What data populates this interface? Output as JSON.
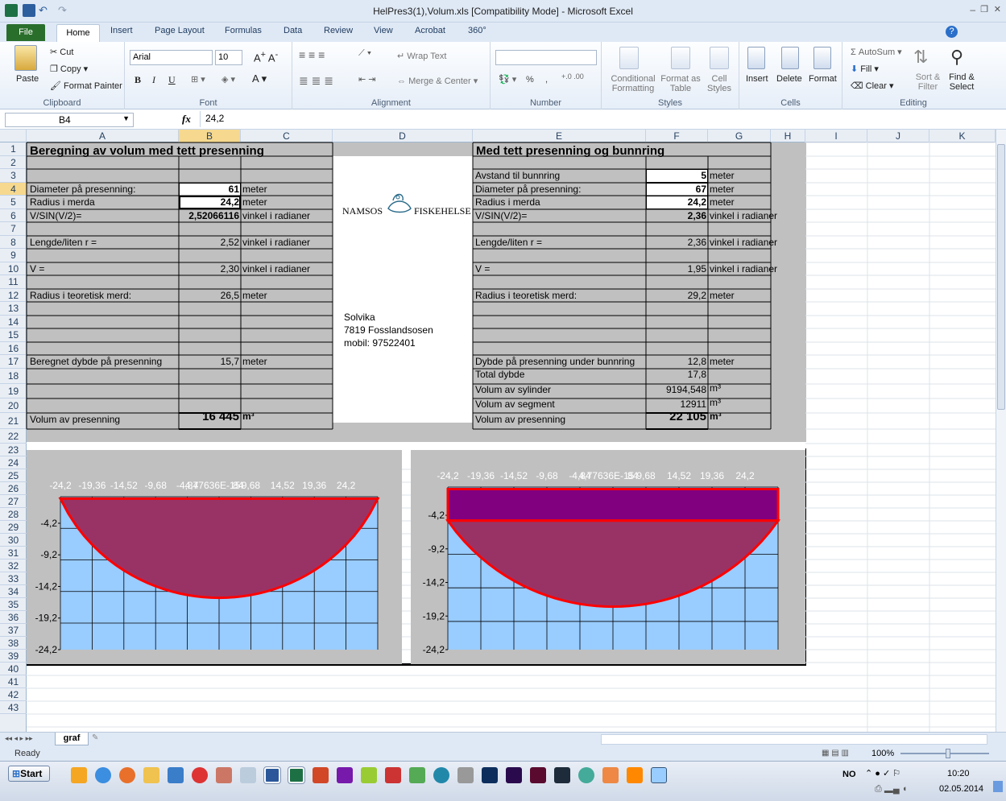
{
  "window": {
    "title": "HelPres3(1),Volum.xls  [Compatibility Mode]  -  Microsoft Excel",
    "min": "–",
    "max": "❐",
    "close": "✕"
  },
  "menu": {
    "file": "File",
    "tabs": [
      "Home",
      "Insert",
      "Page Layout",
      "Formulas",
      "Data",
      "Review",
      "View",
      "Acrobat",
      "360°"
    ]
  },
  "ribbon": {
    "clipboard": {
      "paste": "Paste",
      "cut": "Cut",
      "copy": "Copy",
      "format_painter": "Format Painter",
      "label": "Clipboard"
    },
    "font": {
      "name": "Arial",
      "size": "10",
      "label": "Font"
    },
    "alignment": {
      "wrap": "Wrap Text",
      "merge": "Merge & Center",
      "label": "Alignment"
    },
    "number": {
      "format": "",
      "percent": "%",
      "label": "Number"
    },
    "styles": {
      "conditional": "Conditional Formatting",
      "table": "Format as Table",
      "cell": "Cell Styles",
      "label": "Styles"
    },
    "cells": {
      "insert": "Insert",
      "delete": "Delete",
      "format": "Format",
      "label": "Cells"
    },
    "editing": {
      "autosum": "AutoSum",
      "fill": "Fill",
      "clear": "Clear",
      "sort": "Sort & Filter",
      "find": "Find & Select",
      "label": "Editing"
    }
  },
  "formula": {
    "cell": "B4",
    "fx": "fx",
    "value": "24,2"
  },
  "columns": [
    "A",
    "B",
    "C",
    "D",
    "E",
    "F",
    "G",
    "H",
    "I",
    "J",
    "K"
  ],
  "rows": [
    "1",
    "2",
    "3",
    "4",
    "5",
    "6",
    "7",
    "8",
    "9",
    "10",
    "11",
    "12",
    "13",
    "14",
    "15",
    "16",
    "17",
    "18",
    "19",
    "20",
    "21",
    "22",
    "23",
    "24",
    "25",
    "26",
    "27",
    "28",
    "29",
    "30",
    "31",
    "32",
    "33",
    "34",
    "35",
    "36",
    "37",
    "38",
    "39",
    "40",
    "41",
    "42",
    "43"
  ],
  "left_table": {
    "title": "Beregning av volum med tett presenning",
    "r3": {
      "a": "Diameter på presenning:",
      "b": "61",
      "c": "meter"
    },
    "r4": {
      "a": "Radius i merda",
      "b": "24,2",
      "c": "meter"
    },
    "r5": {
      "a": "V/SIN(V/2)=",
      "b": "2,52066116",
      "c": "vinkel i radianer"
    },
    "r7": {
      "a": "Lengde/liten r =",
      "b": "2,52",
      "c": "vinkel i radianer"
    },
    "r9": {
      "a": "V =",
      "b": "2,30",
      "c": "vinkel i radianer"
    },
    "r11": {
      "a": "Radius i teoretisk merd:",
      "b": "26,5",
      "c": "meter"
    },
    "r16": {
      "a": "Beregnet dybde på presenning",
      "b": "15,7",
      "c": "meter"
    },
    "r20": {
      "a": "Volum av presenning",
      "b": "16 445",
      "c": "m³"
    }
  },
  "logo": {
    "left": "NAMSOS",
    "right": "FISKEHELSE",
    "addr1": "Solvika",
    "addr2": "7819 Fosslandsosen",
    "addr3": "mobil: 97522401"
  },
  "right_table": {
    "title": "Med tett presenning og bunnring",
    "r2": {
      "e": "Avstand til bunnring",
      "f": "5",
      "g": "meter"
    },
    "r3": {
      "e": "Diameter på presenning:",
      "f": "67",
      "g": "meter"
    },
    "r4": {
      "e": "Radius i merda",
      "f": "24,2",
      "g": "meter"
    },
    "r5": {
      "e": "V/SIN(V/2)=",
      "f": "2,36",
      "g": "vinkel i radianer"
    },
    "r7": {
      "e": "Lengde/liten r =",
      "f": "2,36",
      "g": "vinkel i radianer"
    },
    "r9": {
      "e": "V =",
      "f": "1,95",
      "g": "vinkel i radianer"
    },
    "r11": {
      "e": "Radius i teoretisk merd:",
      "f": "29,2",
      "g": "meter"
    },
    "r16": {
      "e": "Dybde på presenning under bunnring",
      "f": "12,8",
      "g": "meter"
    },
    "r17": {
      "e": "Total dybde",
      "f": "17,8",
      "g": ""
    },
    "r18": {
      "e": "Volum av sylinder",
      "f": "9194,548",
      "g": "m³"
    },
    "r19": {
      "e": "Volum av segment",
      "f": "12911",
      "g": "m³"
    },
    "r20": {
      "e": "Volum av presenning",
      "f": "22 105",
      "g": "m³"
    }
  },
  "chart_data": [
    {
      "type": "area",
      "x_ticks": [
        "-24,2",
        "-19,36",
        "-14,52",
        "-9,68",
        "-4,84",
        "4,77636E-15",
        "84",
        "9,68",
        "14,52",
        "19,36",
        "24,2"
      ],
      "y_ticks": [
        "-4,2",
        "-9,2",
        "-14,2",
        "-19,2",
        "-24,2"
      ],
      "ylim": [
        -24.2,
        0
      ],
      "xlim": [
        -24.2,
        24.2
      ],
      "depth": 15.7,
      "radius": 24.2,
      "colors": {
        "fill": "#993366",
        "edge": "#ff0000",
        "bg": "#99ccff",
        "frame": "#c0c0c0"
      }
    },
    {
      "type": "area",
      "x_ticks": [
        "-24,2",
        "-19,36",
        "-14,52",
        "-9,68",
        "-4,84",
        "4,77636E-15",
        "84",
        "9,68",
        "14,52",
        "19,36",
        "24,2"
      ],
      "y_ticks": [
        "-4,2",
        "-9,2",
        "-14,2",
        "-19,2",
        "-24,2"
      ],
      "ylim": [
        -24.2,
        0
      ],
      "xlim": [
        -24.2,
        24.2
      ],
      "ring_depth": 5,
      "total_depth": 17.8,
      "radius": 24.2,
      "colors": {
        "fill": "#993366",
        "cylinder": "#800080",
        "edge": "#ff0000",
        "bg": "#99ccff",
        "frame": "#c0c0c0"
      }
    }
  ],
  "sheet": {
    "tab": "graf"
  },
  "status": {
    "ready": "Ready",
    "zoom": "100%"
  },
  "taskbar": {
    "start": "Start",
    "lang": "NO",
    "time": "10:20",
    "date": "02.05.2014"
  }
}
